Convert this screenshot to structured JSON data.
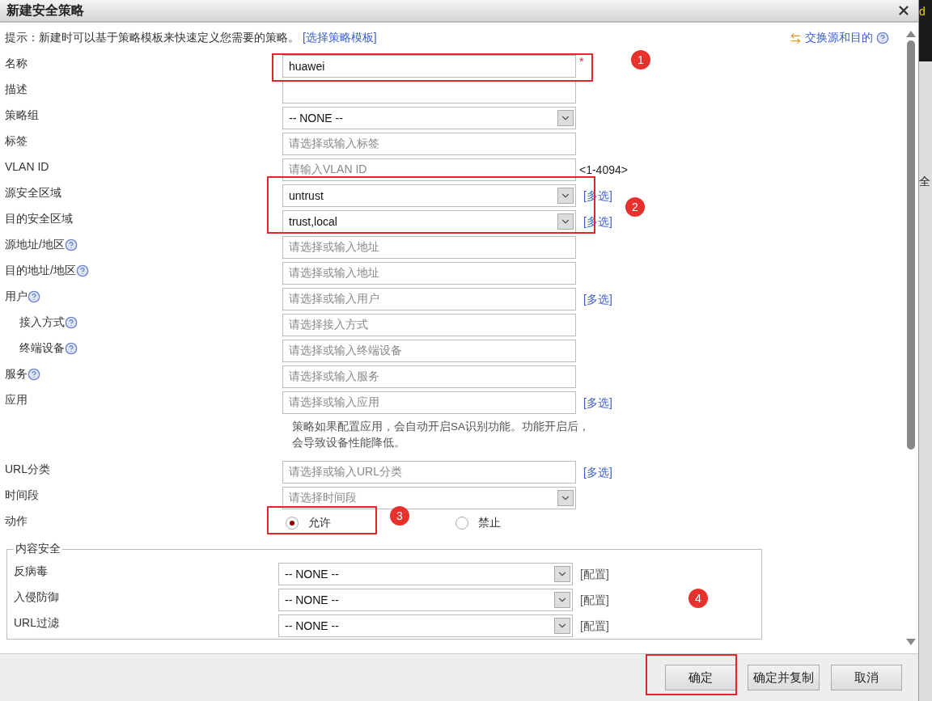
{
  "window": {
    "title": "新建安全策略"
  },
  "hint": {
    "text": "提示：新建时可以基于策略模板来快速定义您需要的策略。",
    "link": "[选择策略模板]"
  },
  "swap_link": "交换源和目的",
  "fields": [
    {
      "label": "名称",
      "kind": "text",
      "value": "huawei",
      "required_mark": "*"
    },
    {
      "label": "描述",
      "kind": "text"
    },
    {
      "label": "策略组",
      "kind": "select",
      "value": "-- NONE --"
    },
    {
      "label": "标签",
      "kind": "text",
      "placeholder": "请选择或输入标签"
    },
    {
      "label": "VLAN ID",
      "kind": "text",
      "placeholder": "请输入VLAN ID",
      "suffix": "<1-4094>"
    },
    {
      "label": "源安全区域",
      "kind": "select",
      "value": "untrust",
      "link": "[多选]"
    },
    {
      "label": "目的安全区域",
      "kind": "select",
      "value": "trust,local",
      "link": "[多选]"
    },
    {
      "label": "源地址/地区",
      "help": true,
      "kind": "text",
      "placeholder": "请选择或输入地址"
    },
    {
      "label": "目的地址/地区",
      "help": true,
      "kind": "text",
      "placeholder": "请选择或输入地址"
    },
    {
      "label": "用户",
      "help": true,
      "kind": "text",
      "placeholder": "请选择或输入用户",
      "link": "[多选]",
      "children": [
        {
          "label": "接入方式",
          "help": true,
          "kind": "text",
          "placeholder": "请选择接入方式"
        },
        {
          "label": "终端设备",
          "help": true,
          "kind": "text",
          "placeholder": "请选择或输入终端设备"
        }
      ]
    },
    {
      "label": "服务",
      "help": true,
      "kind": "text",
      "placeholder": "请选择或输入服务"
    },
    {
      "label": "应用",
      "kind": "text",
      "placeholder": "请选择或输入应用",
      "link": "[多选]",
      "note": "策略如果配置应用，会自动开启SA识别功能。功能开启后，会导致设备性能降低。"
    },
    {
      "label": "URL分类",
      "kind": "text",
      "placeholder": "请选择或输入URL分类",
      "link": "[多选]"
    },
    {
      "label": "时间段",
      "kind": "select",
      "placeholder": "请选择时间段"
    }
  ],
  "action": {
    "label": "动作",
    "options": [
      {
        "label": "允许",
        "selected": true
      },
      {
        "label": "禁止",
        "selected": false
      }
    ]
  },
  "content_security": {
    "title": "内容安全",
    "rows": [
      {
        "label": "反病毒",
        "value": "-- NONE --",
        "link": "[配置]"
      },
      {
        "label": "入侵防御",
        "value": "-- NONE --",
        "link": "[配置]"
      },
      {
        "label": "URL过滤",
        "value": "-- NONE --",
        "link": "[配置]"
      }
    ]
  },
  "buttons": [
    {
      "label": "确定"
    },
    {
      "label": "确定并复制"
    },
    {
      "label": "取消"
    }
  ],
  "annotations": [
    "1",
    "2",
    "3",
    "4"
  ],
  "background": [
    "d",
    "全"
  ]
}
